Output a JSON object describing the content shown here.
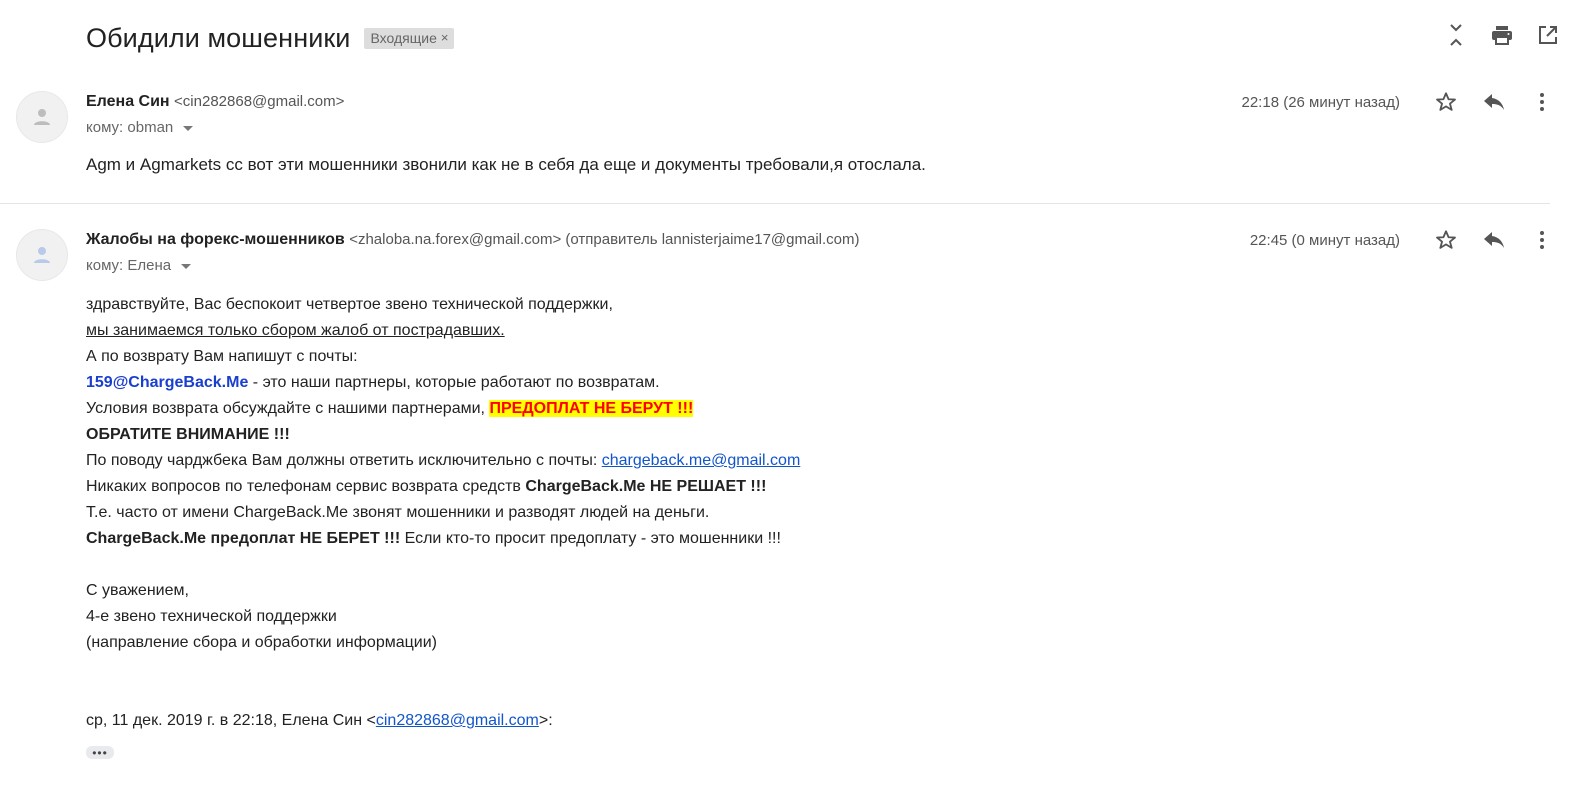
{
  "thread": {
    "subject": "Обидили мошенники",
    "label": "Входящие",
    "label_remove": "×"
  },
  "toolbar": {
    "icons": [
      "expand-collapse-icon",
      "print-icon",
      "open-in-new-window-icon"
    ]
  },
  "messages": [
    {
      "sender_name": "Елена Син",
      "sender_email": "<cin282868@gmail.com>",
      "to": "кому: obman",
      "time": "22:18 (26 минут назад)",
      "snippet": "Agm и Agmarkets cc вот эти мошенники звонили как не в себя да еще и документы требовали,я отослала."
    },
    {
      "sender_name": "Жалобы на форекс-мошенников",
      "sender_email": "<zhaloba.na.forex@gmail.com> (отправитель lannisterjaime17@gmail.com)",
      "to": "кому: Елена",
      "time": "22:45 (0 минут назад)",
      "body": {
        "l1": "здравствуйте, Вас беспокоит четвертое звено технической поддержки,",
        "l2": "мы занимаемся только сбором жалоб от пострадавших.",
        "l3": "А по возврату Вам напишут с почты:",
        "l4_email": "159@ChargeBack.Me",
        "l4_rest": " - это наши партнеры, которые работают по возвратам.",
        "l5_pre": "Условия возврата обсуждайте с нашими партнерами, ",
        "l5_hl": "ПРЕДОПЛАТ НЕ БЕРУТ !!!",
        "l6": "ОБРАТИТЕ ВНИМАНИЕ !!!",
        "l7_pre": "По поводу чарджбека Вам должны ответить исключительно с почты: ",
        "l7_link": "chargeback.me@gmail.com",
        "l8_pre": "Никаких вопросов по телефонам сервис возврата средств ",
        "l8_b": "ChargeBack.Me НЕ РЕШАЕТ !!!",
        "l9": "Т.е. часто от имени ChargeBack.Me звонят мошенники и разводят людей на деньги.",
        "l10_b": "ChargeBack.Me предоплат НЕ БЕРЕТ !!!",
        "l10_rest": " Если кто-то просит предоплату - это мошенники !!!",
        "sig1": "С уважением,",
        "sig2": "4-е звено технической поддержки",
        "sig3": "(направление сбора и обработки информации)",
        "quote_pre": "ср, 11 дек. 2019 г. в 22:18, Елена Син <",
        "quote_link": "cin282868@gmail.com",
        "quote_post": ">:",
        "ellipsis": "•••"
      }
    }
  ]
}
